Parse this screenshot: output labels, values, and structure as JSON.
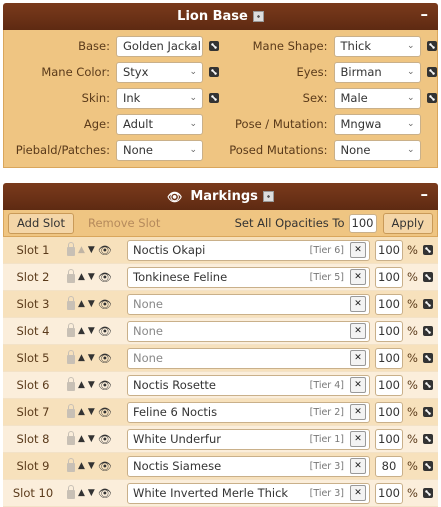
{
  "lion_base": {
    "title": "Lion Base",
    "collapse_label": "–",
    "left_fields": [
      {
        "label": "Base:",
        "value": "Golden Jackal"
      },
      {
        "label": "Mane Color:",
        "value": "Styx"
      },
      {
        "label": "Skin:",
        "value": "Ink"
      },
      {
        "label": "Age:",
        "value": "Adult"
      },
      {
        "label": "Piebald/Patches:",
        "value": "None"
      }
    ],
    "right_fields": [
      {
        "label": "Mane Shape:",
        "value": "Thick"
      },
      {
        "label": "Eyes:",
        "value": "Birman"
      },
      {
        "label": "Sex:",
        "value": "Male"
      },
      {
        "label": "Pose / Mutation:",
        "value": "Mngwa"
      },
      {
        "label": "Posed Mutations:",
        "value": "None"
      }
    ]
  },
  "markings": {
    "title": "Markings",
    "collapse_label": "–",
    "add_slot_label": "Add Slot",
    "remove_slot_label": "Remove Slot",
    "set_all_label": "Set All Opacities To",
    "set_all_value": "100",
    "apply_label": "Apply",
    "percent_sign": "%",
    "clear_label": "✕",
    "slots": [
      {
        "label": "Slot 1",
        "name": "Noctis Okapi",
        "tier": "[Tier 6]",
        "opacity": "100"
      },
      {
        "label": "Slot 2",
        "name": "Tonkinese Feline",
        "tier": "[Tier 5]",
        "opacity": "100"
      },
      {
        "label": "Slot 3",
        "name": "None",
        "tier": "",
        "opacity": "100"
      },
      {
        "label": "Slot 4",
        "name": "None",
        "tier": "",
        "opacity": "100"
      },
      {
        "label": "Slot 5",
        "name": "None",
        "tier": "",
        "opacity": "100"
      },
      {
        "label": "Slot 6",
        "name": "Noctis Rosette",
        "tier": "[Tier 4]",
        "opacity": "100"
      },
      {
        "label": "Slot 7",
        "name": "Feline 6 Noctis",
        "tier": "[Tier 2]",
        "opacity": "100"
      },
      {
        "label": "Slot 8",
        "name": "White Underfur",
        "tier": "[Tier 1]",
        "opacity": "100"
      },
      {
        "label": "Slot 9",
        "name": "Noctis Siamese",
        "tier": "[Tier 3]",
        "opacity": "80"
      },
      {
        "label": "Slot 10",
        "name": "White Inverted Merle Thick",
        "tier": "[Tier 3]",
        "opacity": "100"
      }
    ]
  },
  "icons": {
    "dice": "dice-icon",
    "eye": "eye-icon",
    "lock": "lock-icon",
    "up": "arrow-up-icon",
    "down": "arrow-down-icon",
    "chevron": "chevron-down-icon"
  },
  "colors": {
    "header": "#6b3017",
    "panel_bg": "#efc582",
    "row_odd": "#f7e1bc",
    "row_even": "#fbeedb"
  }
}
